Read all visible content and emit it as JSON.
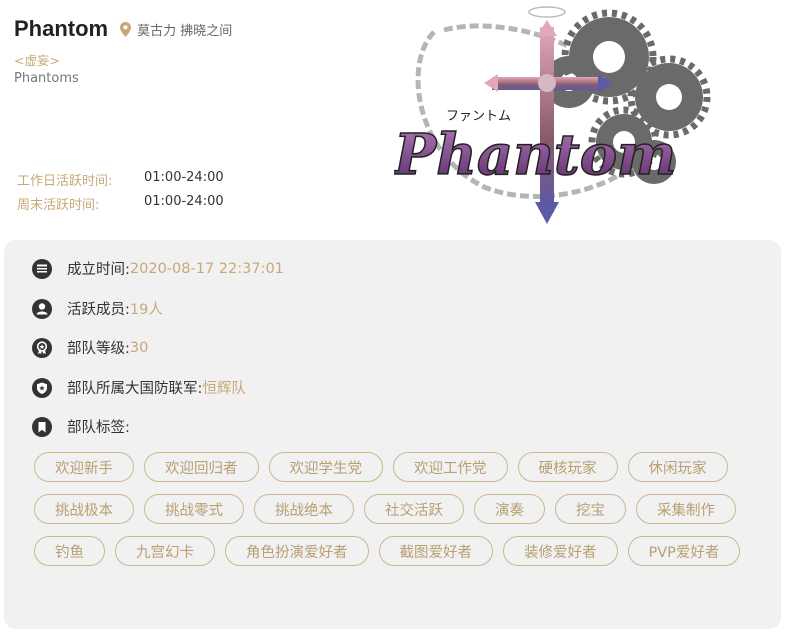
{
  "header": {
    "fc_name": "Phantom",
    "location": "莫古力 拂晓之间",
    "fc_tag": "<虚妄>",
    "fc_name_en": "Phantoms",
    "active_times": [
      {
        "label": "工作日活跃时间:",
        "value": "01:00-24:00"
      },
      {
        "label": "周末活跃时间:",
        "value": "01:00-24:00"
      }
    ],
    "crest": {
      "katakana": "ファントム",
      "logo_text": "Phantom",
      "colors": {
        "cross": "#9a6a7a",
        "gear": "#666666",
        "chain": "#b0b0b0",
        "logo_fill": "#6a3a8a"
      }
    }
  },
  "info": {
    "founded": {
      "label": "成立时间:",
      "value": "2020-08-17 22:37:01",
      "icon": "calendar-icon"
    },
    "members": {
      "label": "活跃成员:",
      "value": "19人",
      "icon": "user-icon"
    },
    "rank": {
      "label": "部队等级:",
      "value": "30",
      "icon": "rank-badge-icon"
    },
    "grand_company": {
      "label": "部队所属大国防联军:",
      "value": "恒辉队",
      "icon": "shield-icon"
    },
    "tags_label": {
      "label": "部队标签:",
      "icon": "bookmark-icon"
    }
  },
  "tags": [
    "欢迎新手",
    "欢迎回归者",
    "欢迎学生党",
    "欢迎工作党",
    "硬核玩家",
    "休闲玩家",
    "挑战极本",
    "挑战零式",
    "挑战绝本",
    "社交活跃",
    "演奏",
    "挖宝",
    "采集制作",
    "钓鱼",
    "九宫幻卡",
    "角色扮演爱好者",
    "截图爱好者",
    "装修爱好者",
    "PVP爱好者"
  ],
  "colors": {
    "accent": "#c8a878",
    "panel_bg": "#f1f1f1",
    "tag_border": "#cbb78e",
    "icon": "#333333"
  }
}
